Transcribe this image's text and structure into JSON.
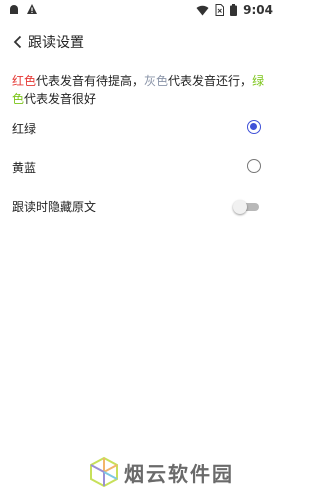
{
  "status_bar": {
    "time": "9:04",
    "icons": [
      "android-icon",
      "warning-icon",
      "wifi-icon",
      "sim-icon",
      "battery-icon"
    ]
  },
  "header": {
    "title": "跟读设置",
    "back_icon": "chevron-left-icon"
  },
  "legend": {
    "red_word": "红色",
    "red_text": "代表发音有待提高，",
    "gray_word": "灰色",
    "gray_text": "代表发音还行，",
    "green_word": "绿色",
    "green_text": "代表发音很好",
    "colors": {
      "red": "#e53935",
      "gray": "#8a94a8",
      "green": "#7cc51a"
    }
  },
  "options": {
    "red_green": {
      "label": "红绿",
      "selected": true
    },
    "yellow_blue": {
      "label": "黄蓝",
      "selected": false
    }
  },
  "hide_original": {
    "label": "跟读时隐藏原文",
    "enabled": false
  },
  "watermark": {
    "text": "烟云软件园"
  },
  "accent_color": "#3f51d8"
}
